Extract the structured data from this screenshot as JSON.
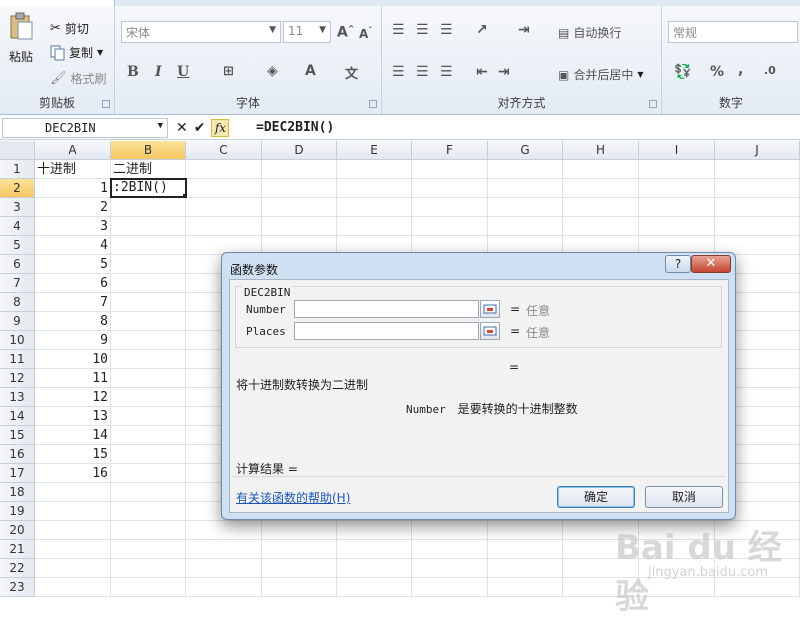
{
  "ribbon": {
    "clipboard": {
      "paste": "粘贴",
      "cut": "剪切",
      "copy": "复制",
      "format_painter": "格式刷",
      "label": "剪贴板"
    },
    "font": {
      "font_name": "宋体",
      "font_size": "11",
      "bold": "B",
      "italic": "I",
      "underline": "U",
      "label": "字体"
    },
    "alignment": {
      "wrap_text": "自动换行",
      "merge_center": "合并后居中",
      "label": "对齐方式"
    },
    "number": {
      "format": "常规",
      "percent": "%",
      "comma": ",",
      "label": "数字"
    }
  },
  "formula_bar": {
    "name_box": "DEC2BIN",
    "fx": "fx",
    "formula": "=DEC2BIN()"
  },
  "grid": {
    "columns": [
      "A",
      "B",
      "C",
      "D",
      "E",
      "F",
      "G",
      "H",
      "I",
      "J"
    ],
    "rows": [
      "1",
      "2",
      "3",
      "4",
      "5",
      "6",
      "7",
      "8",
      "9",
      "10",
      "11",
      "12",
      "13",
      "14",
      "15",
      "16",
      "17",
      "18",
      "19",
      "20",
      "21",
      "22",
      "23"
    ],
    "a1": "十进制",
    "b1": "二进制",
    "a_values": [
      "1",
      "2",
      "3",
      "4",
      "5",
      "6",
      "7",
      "8",
      "9",
      "10",
      "11",
      "12",
      "13",
      "14",
      "15",
      "16"
    ],
    "active_cell_text": ":2BIN()"
  },
  "dialog": {
    "title": "函数参数",
    "help_btn": "?",
    "close_btn": "✕",
    "func_name": "DEC2BIN",
    "args": [
      {
        "label": "Number",
        "eq": "=",
        "value": "任意"
      },
      {
        "label": "Places",
        "eq": "=",
        "value": "任意"
      }
    ],
    "result_eq": "=",
    "description": "将十进制数转换为二进制",
    "arg_name": "Number",
    "arg_description": "是要转换的十进制整数",
    "calc_result": "计算结果 =",
    "help_link": "有关该函数的帮助(H)",
    "ok": "确定",
    "cancel": "取消"
  },
  "watermark": {
    "brand": "Bai du 经验",
    "url": "jingyan.baidu.com"
  }
}
